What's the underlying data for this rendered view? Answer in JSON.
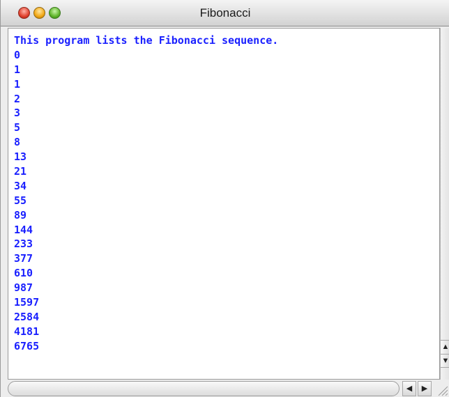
{
  "window": {
    "title": "Fibonacci"
  },
  "output": {
    "lines": [
      "This program lists the Fibonacci sequence.",
      "0",
      "1",
      "1",
      "2",
      "3",
      "5",
      "8",
      "13",
      "21",
      "34",
      "55",
      "89",
      "144",
      "233",
      "377",
      "610",
      "987",
      "1597",
      "2584",
      "4181",
      "6765"
    ]
  },
  "colors": {
    "text": "#1a20ff",
    "close_button": "#e0402c",
    "minimize_button": "#f1a714",
    "zoom_button": "#5fb42a"
  },
  "icons": {
    "close": "close-traffic-light-icon",
    "minimize": "minimize-traffic-light-icon",
    "zoom": "zoom-traffic-light-icon",
    "scroll_up": "arrow-up-icon",
    "scroll_down": "arrow-down-icon",
    "scroll_left": "arrow-left-icon",
    "scroll_right": "arrow-right-icon",
    "resize": "resize-grip-icon"
  }
}
